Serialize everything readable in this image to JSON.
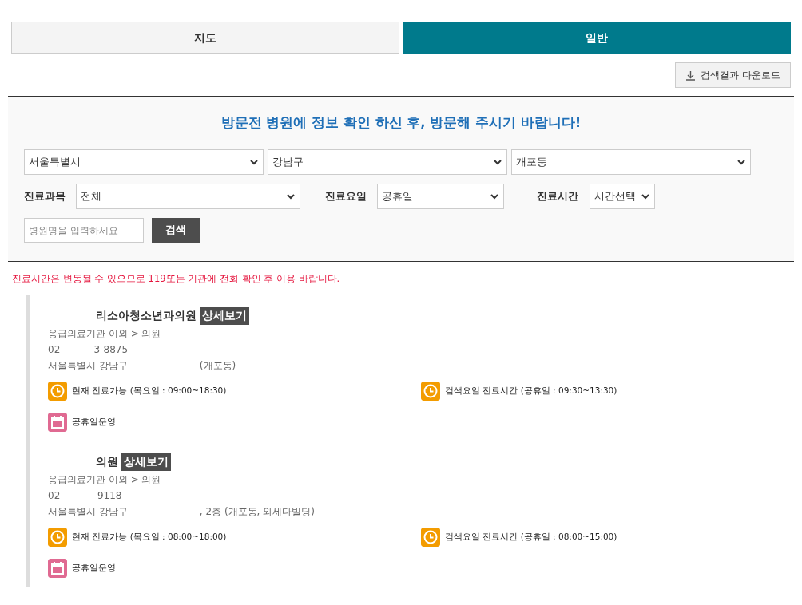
{
  "tabs": [
    {
      "label": "지도",
      "selected": false
    },
    {
      "label": "일반",
      "selected": true
    }
  ],
  "download_button": "검색결과 다운로드",
  "search_panel": {
    "title": "방문전 병원에 정보 확인 하신 후, 방문해 주시기 바랍니다!",
    "region_selects": [
      {
        "value": "서울특별시"
      },
      {
        "value": "강남구"
      },
      {
        "value": "개포동"
      }
    ],
    "filters": [
      {
        "label": "진료과목",
        "value": "전체"
      },
      {
        "label": "진료요일",
        "value": "공휴일"
      },
      {
        "label": "진료시간",
        "value": "시간선택"
      }
    ],
    "name_field": {
      "placeholder": "병원명을 입력하세요"
    },
    "search_button": "검색"
  },
  "notice": "진료시간은 변동될 수 있으므로 119또는 기관에 전화 확인 후 이용 바랍니다.",
  "results": [
    {
      "name": [
        "리소아청소년과의원"
      ],
      "detail_button": "상세보기",
      "category": "응급의료기관 이외 > 의원",
      "phone": [
        "02-",
        "3-8875"
      ],
      "address": [
        "서울특별시 강남구",
        "(개포동)"
      ],
      "hours": [
        {
          "text": "현재 진료가능 (목요일 : 09:00~18:30)"
        },
        {
          "text": "검색요일 진료시간 (공휴일 : 09:30~13:30)"
        }
      ],
      "holiday": "공휴일운영"
    },
    {
      "name": [
        "의원"
      ],
      "detail_button": "상세보기",
      "category": "응급의료기관 이외 > 의원",
      "phone": [
        "02-",
        "-9118"
      ],
      "address": [
        "서울특별시 강남구",
        ", 2층 (개포동, 와세다빌딩)"
      ],
      "hours": [
        {
          "text": "현재 진료가능 (목요일 : 08:00~18:00)"
        },
        {
          "text": "검색요일 진료시간 (공휴일 : 08:00~15:00)"
        }
      ],
      "holiday": "공휴일운영"
    }
  ]
}
